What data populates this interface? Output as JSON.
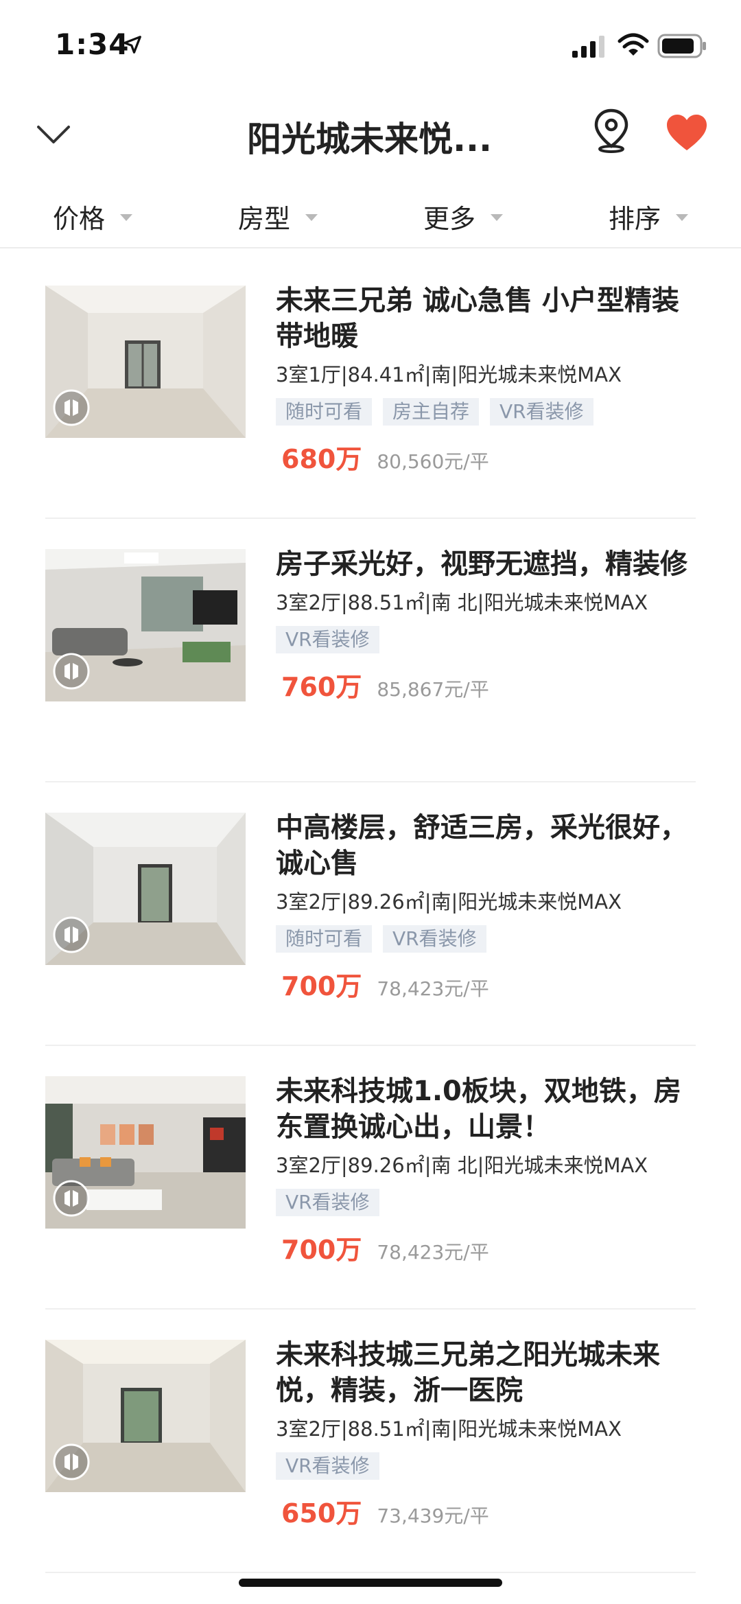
{
  "status": {
    "time": "1:34"
  },
  "header": {
    "title": "阳光城未来悦..."
  },
  "filters": [
    {
      "label": "价格"
    },
    {
      "label": "房型"
    },
    {
      "label": "更多"
    },
    {
      "label": "排序"
    }
  ],
  "listings": [
    {
      "title": "未来三兄弟 诚心急售 小户型精装带地暖",
      "meta": "3室1厅|84.41㎡|南|阳光城未来悦MAX",
      "tags": [
        "随时可看",
        "房主自荐",
        "VR看装修"
      ],
      "price": "680万",
      "unit_price": "80,560元/平"
    },
    {
      "title": "房子采光好，视野无遮挡，精装修",
      "meta": "3室2厅|88.51㎡|南 北|阳光城未来悦MAX",
      "tags": [
        "VR看装修"
      ],
      "price": "760万",
      "unit_price": "85,867元/平"
    },
    {
      "title": "中高楼层，舒适三房，采光很好，诚心售",
      "meta": "3室2厅|89.26㎡|南|阳光城未来悦MAX",
      "tags": [
        "随时可看",
        "VR看装修"
      ],
      "price": "700万",
      "unit_price": "78,423元/平"
    },
    {
      "title": "未来科技城1.0板块，双地铁，房东置换诚心出，山景！",
      "meta": "3室2厅|89.26㎡|南 北|阳光城未来悦MAX",
      "tags": [
        "VR看装修"
      ],
      "price": "700万",
      "unit_price": "78,423元/平"
    },
    {
      "title": "未来科技城三兄弟之阳光城未来悦，精装，浙一医院",
      "meta": "3室2厅|88.51㎡|南|阳光城未来悦MAX",
      "tags": [
        "VR看装修"
      ],
      "price": "650万",
      "unit_price": "73,439元/平"
    }
  ],
  "colors": {
    "accent": "#f0543c",
    "tag_bg": "#eef1f5",
    "tag_text": "#8a97aa"
  }
}
